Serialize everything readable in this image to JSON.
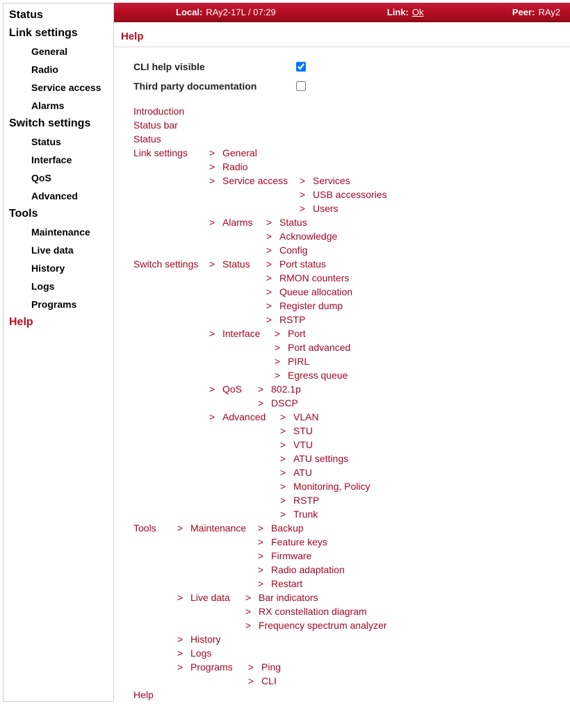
{
  "status_bar": {
    "local_label": "Local:",
    "local_value": "RAy2-17L / 07:29",
    "link_label": "Link:",
    "link_value": "Ok",
    "peer_label": "Peer:",
    "peer_value": "RAy2"
  },
  "sidebar": {
    "sections": [
      {
        "title": "Status",
        "items": []
      },
      {
        "title": "Link settings",
        "items": [
          "General",
          "Radio",
          "Service access",
          "Alarms"
        ]
      },
      {
        "title": "Switch settings",
        "items": [
          "Status",
          "Interface",
          "QoS",
          "Advanced"
        ]
      },
      {
        "title": "Tools",
        "items": [
          "Maintenance",
          "Live data",
          "History",
          "Logs",
          "Programs"
        ]
      }
    ],
    "help": "Help"
  },
  "page": {
    "title": "Help",
    "cli_label": "CLI help visible",
    "cli_checked": true,
    "third_label": "Third party documentation",
    "third_checked": false
  },
  "tree": [
    {
      "sec": "Introduction"
    },
    {
      "sec": "Status bar"
    },
    {
      "sec": "Status"
    },
    {
      "sec": "Link settings",
      "l2": "General"
    },
    {
      "sec": "",
      "l2": "Radio"
    },
    {
      "sec": "",
      "l2": "Service access",
      "l3": "Services"
    },
    {
      "sec": "",
      "l2": "",
      "l3": "USB accessories"
    },
    {
      "sec": "",
      "l2": "",
      "l3": "Users"
    },
    {
      "sec": "",
      "l2": "Alarms",
      "l3": "Status"
    },
    {
      "sec": "",
      "l2": "",
      "l3": "Acknowledge"
    },
    {
      "sec": "",
      "l2": "",
      "l3": "Config"
    },
    {
      "sec": "Switch settings",
      "l2": "Status",
      "l3": "Port status"
    },
    {
      "sec": "",
      "l2": "",
      "l3": "RMON counters"
    },
    {
      "sec": "",
      "l2": "",
      "l3": "Queue allocation"
    },
    {
      "sec": "",
      "l2": "",
      "l3": "Register dump"
    },
    {
      "sec": "",
      "l2": "",
      "l3": "RSTP"
    },
    {
      "sec": "",
      "l2": "Interface",
      "l3": "Port"
    },
    {
      "sec": "",
      "l2": "",
      "l3": "Port advanced"
    },
    {
      "sec": "",
      "l2": "",
      "l3": "PIRL"
    },
    {
      "sec": "",
      "l2": "",
      "l3": "Egress queue"
    },
    {
      "sec": "",
      "l2": "QoS",
      "l3": "802.1p"
    },
    {
      "sec": "",
      "l2": "",
      "l3": "DSCP"
    },
    {
      "sec": "",
      "l2": "Advanced",
      "l3": "VLAN"
    },
    {
      "sec": "",
      "l2": "",
      "l3": "STU"
    },
    {
      "sec": "",
      "l2": "",
      "l3": "VTU"
    },
    {
      "sec": "",
      "l2": "",
      "l3": "ATU settings"
    },
    {
      "sec": "",
      "l2": "",
      "l3": "ATU"
    },
    {
      "sec": "",
      "l2": "",
      "l3": "Monitoring, Policy"
    },
    {
      "sec": "",
      "l2": "",
      "l3": "RSTP"
    },
    {
      "sec": "",
      "l2": "",
      "l3": "Trunk"
    },
    {
      "sec": "Tools",
      "l2": "Maintenance",
      "l3": "Backup"
    },
    {
      "sec": "",
      "l2": "",
      "l3": "Feature keys"
    },
    {
      "sec": "",
      "l2": "",
      "l3": "Firmware"
    },
    {
      "sec": "",
      "l2": "",
      "l3": "Radio adaptation"
    },
    {
      "sec": "",
      "l2": "",
      "l3": "Restart"
    },
    {
      "sec": "",
      "l2": "Live data",
      "l3": "Bar indicators"
    },
    {
      "sec": "",
      "l2": "",
      "l3": "RX constellation diagram"
    },
    {
      "sec": "",
      "l2": "",
      "l3": "Frequency spectrum analyzer"
    },
    {
      "sec": "",
      "l2": "History"
    },
    {
      "sec": "",
      "l2": "Logs"
    },
    {
      "sec": "",
      "l2": "Programs",
      "l3": "Ping"
    },
    {
      "sec": "",
      "l2": "",
      "l3": "CLI"
    },
    {
      "sec": "Help"
    }
  ],
  "widths": {
    "secW": {
      "": 98,
      "Introduction": 98,
      "Status bar": 98,
      "Status": 98,
      "Link settings": 98,
      "Switch settings": 98,
      "Tools": 52,
      "Help": 98
    },
    "l2W": {
      "General": 100,
      "Radio": 100,
      "Service access": 100,
      "Alarms": 52,
      "Status": 52,
      "Interface": 64,
      "QoS": 40,
      "Advanced": 72,
      "Maintenance": 86,
      "Live data": 68,
      "History": 68,
      "Logs": 68,
      "Programs": 72
    }
  }
}
